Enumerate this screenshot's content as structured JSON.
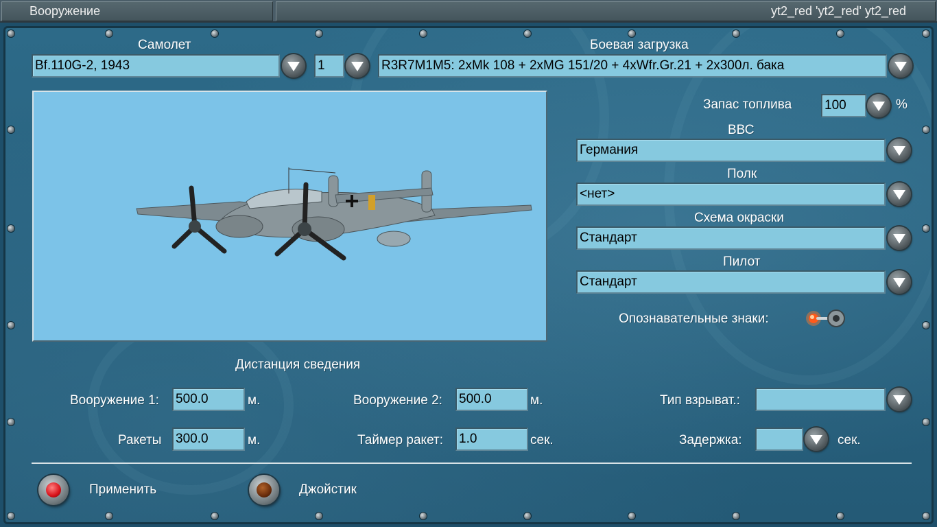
{
  "window": {
    "title": "Вооружение",
    "player": "yt2_red 'yt2_red' yt2_red"
  },
  "aircraft": {
    "label": "Самолет",
    "value": "Bf.110G-2, 1943",
    "count": "1"
  },
  "loadout": {
    "label": "Боевая загрузка",
    "value": "R3R7M1M5: 2xMk 108 + 2xMG 151/20 + 4xWfr.Gr.21 + 2x300л. бака"
  },
  "fuel": {
    "label": "Запас топлива",
    "value": "100",
    "unit": "%"
  },
  "air_force": {
    "label": "ВВС",
    "value": "Германия"
  },
  "regiment": {
    "label": "Полк",
    "value": "<нет>"
  },
  "paint_scheme": {
    "label": "Схема окраски",
    "value": "Стандарт"
  },
  "pilot": {
    "label": "Пилот",
    "value": "Стандарт"
  },
  "markings": {
    "label": "Опознавательные знаки:",
    "enabled": true
  },
  "convergence": {
    "title": "Дистанция сведения",
    "weapon1_label": "Вооружение 1:",
    "weapon1_value": "500.0",
    "weapon1_unit": "м.",
    "weapon2_label": "Вооружение 2:",
    "weapon2_value": "500.0",
    "weapon2_unit": "м.",
    "rockets_label": "Ракеты",
    "rockets_value": "300.0",
    "rockets_unit": "м.",
    "rocket_timer_label": "Таймер ракет:",
    "rocket_timer_value": "1.0",
    "rocket_timer_unit": "сек.",
    "fuze_type_label": "Тип взрыват.:",
    "fuze_type_value": "",
    "delay_label": "Задержка:",
    "delay_value": "",
    "delay_unit": "сек."
  },
  "buttons": {
    "apply": "Применить",
    "joystick": "Джойстик"
  },
  "colors": {
    "panel": "#2d6a88",
    "field": "#86c9df",
    "sky": "#7cc3e8",
    "apply_lamp": "#d8121a",
    "joystick_lamp": "#6b2e0c"
  }
}
